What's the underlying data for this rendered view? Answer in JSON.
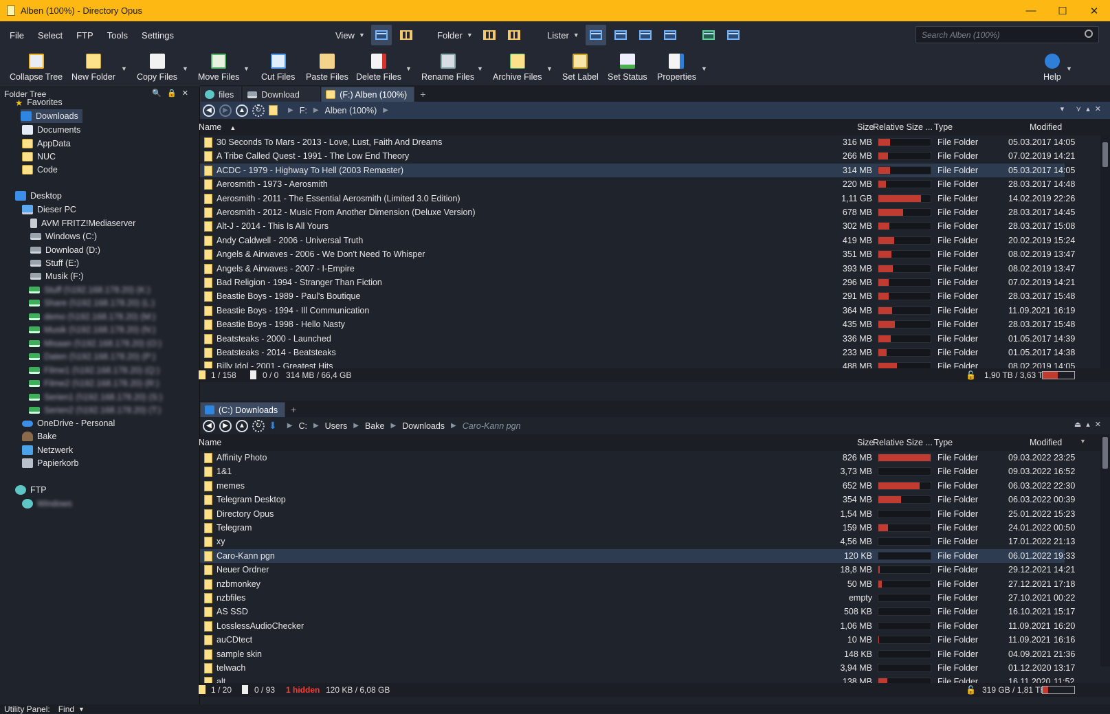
{
  "window": {
    "title": "Alben (100%) - Directory Opus",
    "min": "—",
    "max": "☐",
    "close": "✕"
  },
  "menu": {
    "file": "File",
    "select": "Select",
    "ftp": "FTP",
    "tools": "Tools",
    "settings": "Settings",
    "view": "View",
    "folder": "Folder",
    "lister": "Lister"
  },
  "search": {
    "placeholder": "Search Alben (100%)"
  },
  "toolbar": {
    "collapse_tree": "Collapse Tree",
    "new_folder": "New Folder",
    "copy_files": "Copy Files",
    "move_files": "Move Files",
    "cut_files": "Cut Files",
    "paste_files": "Paste Files",
    "delete_files": "Delete Files",
    "rename_files": "Rename Files",
    "archive_files": "Archive Files",
    "set_label": "Set Label",
    "set_status": "Set Status",
    "properties": "Properties",
    "help": "Help"
  },
  "tree": {
    "header": "Folder Tree",
    "favorites": "Favorites",
    "fav_items": [
      "Downloads",
      "Documents",
      "AppData",
      "NUC",
      "Code"
    ],
    "desktop": "Desktop",
    "this_pc": "Dieser PC",
    "pc_items": [
      "AVM FRITZ!Mediaserver",
      "Windows (C:)",
      "Download (D:)",
      "Stuff (E:)",
      "Musik (F:)"
    ],
    "net_items": [
      "Stuff (\\\\192.168.178.20) (K:)",
      "Share (\\\\192.168.178.20) (L:)",
      "demo (\\\\192.168.178.20) (M:)",
      "Musik (\\\\192.168.178.20) (N:)",
      "Misaan (\\\\192.168.178.20) (O:)",
      "Daten (\\\\192.168.178.20) (P:)",
      "Filme1 (\\\\192.168.178.20) (Q:)",
      "Filme2 (\\\\192.168.178.20) (R:)",
      "Serien1 (\\\\192.168.178.20) (S:)",
      "Serien2 (\\\\192.168.178.20) (T:)"
    ],
    "onedrive": "OneDrive - Personal",
    "bake": "Bake",
    "netzwerk": "Netzwerk",
    "papierkorb": "Papierkorb",
    "ftp": "FTP",
    "ftp_child": "Windows"
  },
  "top_lister": {
    "tabs": [
      "files",
      "Download",
      "(F:) Alben (100%)"
    ],
    "path": [
      "F:",
      "Alben (100%)"
    ],
    "columns": {
      "name": "Name",
      "size": "Size",
      "relsize": "Relative Size ...",
      "type": "Type",
      "modified": "Modified"
    },
    "rows": [
      {
        "name": "30 Seconds To Mars - 2013 - Love, Lust, Faith And Dreams",
        "size": "316 MB",
        "rel": 0.22,
        "type": "File Folder",
        "date": "05.03.2017",
        "time": "14:05"
      },
      {
        "name": "A Tribe Called Quest - 1991 - The Low End Theory",
        "size": "266 MB",
        "rel": 0.18,
        "type": "File Folder",
        "date": "07.02.2019",
        "time": "14:21"
      },
      {
        "name": "ACDC - 1979 - Highway To Hell (2003 Remaster)",
        "size": "314 MB",
        "rel": 0.22,
        "type": "File Folder",
        "date": "05.03.2017",
        "time": "14:05",
        "selected": true
      },
      {
        "name": "Aerosmith - 1973 - Aerosmith",
        "size": "220 MB",
        "rel": 0.15,
        "type": "File Folder",
        "date": "28.03.2017",
        "time": "14:48"
      },
      {
        "name": "Aerosmith - 2011 - The Essential Aerosmith (Limited 3.0 Edition)",
        "size": "1,11 GB",
        "rel": 0.82,
        "type": "File Folder",
        "date": "14.02.2019",
        "time": "22:26"
      },
      {
        "name": "Aerosmith - 2012 - Music From Another Dimension (Deluxe Version)",
        "size": "678 MB",
        "rel": 0.48,
        "type": "File Folder",
        "date": "28.03.2017",
        "time": "14:45"
      },
      {
        "name": "Alt-J - 2014 - This Is All Yours",
        "size": "302 MB",
        "rel": 0.21,
        "type": "File Folder",
        "date": "28.03.2017",
        "time": "15:08"
      },
      {
        "name": "Andy Caldwell - 2006 - Universal Truth",
        "size": "419 MB",
        "rel": 0.3,
        "type": "File Folder",
        "date": "20.02.2019",
        "time": "15:24"
      },
      {
        "name": "Angels & Airwaves - 2006 - We Don't Need To Whisper",
        "size": "351 MB",
        "rel": 0.25,
        "type": "File Folder",
        "date": "08.02.2019",
        "time": "13:47"
      },
      {
        "name": "Angels & Airwaves - 2007 - I-Empire",
        "size": "393 MB",
        "rel": 0.28,
        "type": "File Folder",
        "date": "08.02.2019",
        "time": "13:47"
      },
      {
        "name": "Bad Religion - 1994 - Stranger Than Fiction",
        "size": "296 MB",
        "rel": 0.2,
        "type": "File Folder",
        "date": "07.02.2019",
        "time": "14:21"
      },
      {
        "name": "Beastie Boys - 1989 - Paul's Boutique",
        "size": "291 MB",
        "rel": 0.2,
        "type": "File Folder",
        "date": "28.03.2017",
        "time": "15:48"
      },
      {
        "name": "Beastie Boys - 1994 - Ill Communication",
        "size": "364 MB",
        "rel": 0.26,
        "type": "File Folder",
        "date": "11.09.2021",
        "time": "16:19"
      },
      {
        "name": "Beastie Boys - 1998 - Hello Nasty",
        "size": "435 MB",
        "rel": 0.31,
        "type": "File Folder",
        "date": "28.03.2017",
        "time": "15:48"
      },
      {
        "name": "Beatsteaks - 2000 - Launched",
        "size": "336 MB",
        "rel": 0.24,
        "type": "File Folder",
        "date": "01.05.2017",
        "time": "14:39"
      },
      {
        "name": "Beatsteaks - 2014 - Beatsteaks",
        "size": "233 MB",
        "rel": 0.16,
        "type": "File Folder",
        "date": "01.05.2017",
        "time": "14:38"
      },
      {
        "name": "Billy Idol - 2001 - Greatest Hits",
        "size": "488 MB",
        "rel": 0.35,
        "type": "File Folder",
        "date": "08.02.2019",
        "time": "14:05"
      }
    ],
    "status": {
      "sel": "1 / 158",
      "files": "0 / 0",
      "size": "314 MB / 66,4 GB",
      "free": "1,90 TB / 3,63 TB",
      "free_fill": 0.48
    }
  },
  "bottom_lister": {
    "tabs": [
      "(C:) Downloads"
    ],
    "path": [
      "C:",
      "Users",
      "Bake",
      "Downloads",
      "Caro-Kann pgn"
    ],
    "columns": {
      "name": "Name",
      "size": "Size",
      "relsize": "Relative Size ...",
      "type": "Type",
      "modified": "Modified"
    },
    "rows": [
      {
        "name": "Affinity Photo",
        "size": "826 MB",
        "rel": 1.0,
        "type": "File Folder",
        "date": "09.03.2022",
        "time": "23:25"
      },
      {
        "name": "1&1",
        "size": "3,73 MB",
        "rel": 0.0,
        "type": "File Folder",
        "date": "09.03.2022",
        "time": "16:52"
      },
      {
        "name": "memes",
        "size": "652 MB",
        "rel": 0.79,
        "type": "File Folder",
        "date": "06.03.2022",
        "time": "22:30"
      },
      {
        "name": "Telegram Desktop",
        "size": "354 MB",
        "rel": 0.43,
        "type": "File Folder",
        "date": "06.03.2022",
        "time": "00:39"
      },
      {
        "name": "Directory Opus",
        "size": "1,54 MB",
        "rel": 0.0,
        "type": "File Folder",
        "date": "25.01.2022",
        "time": "15:23"
      },
      {
        "name": "Telegram",
        "size": "159 MB",
        "rel": 0.19,
        "type": "File Folder",
        "date": "24.01.2022",
        "time": "00:50"
      },
      {
        "name": "xy",
        "size": "4,56 MB",
        "rel": 0.0,
        "type": "File Folder",
        "date": "17.01.2022",
        "time": "21:13"
      },
      {
        "name": "Caro-Kann pgn",
        "size": "120 KB",
        "rel": 0.0,
        "type": "File Folder",
        "date": "06.01.2022",
        "time": "19:33",
        "selected": true
      },
      {
        "name": "Neuer Ordner",
        "size": "18,8 MB",
        "rel": 0.02,
        "type": "File Folder",
        "date": "29.12.2021",
        "time": "14:21"
      },
      {
        "name": "nzbmonkey",
        "size": "50 MB",
        "rel": 0.06,
        "type": "File Folder",
        "date": "27.12.2021",
        "time": "17:18"
      },
      {
        "name": "nzbfiles",
        "size": "empty",
        "rel": 0.0,
        "type": "File Folder",
        "date": "27.10.2021",
        "time": "00:22"
      },
      {
        "name": "AS SSD",
        "size": "508 KB",
        "rel": 0.0,
        "type": "File Folder",
        "date": "16.10.2021",
        "time": "15:17"
      },
      {
        "name": "LosslessAudioChecker",
        "size": "1,06 MB",
        "rel": 0.0,
        "type": "File Folder",
        "date": "11.09.2021",
        "time": "16:20"
      },
      {
        "name": "auCDtect",
        "size": "10 MB",
        "rel": 0.01,
        "type": "File Folder",
        "date": "11.09.2021",
        "time": "16:16"
      },
      {
        "name": "sample skin",
        "size": "148 KB",
        "rel": 0.0,
        "type": "File Folder",
        "date": "04.09.2021",
        "time": "21:36"
      },
      {
        "name": "telwach",
        "size": "3,94 MB",
        "rel": 0.0,
        "type": "File Folder",
        "date": "01.12.2020",
        "time": "13:17"
      },
      {
        "name": "alt",
        "size": "138 MB",
        "rel": 0.17,
        "type": "File Folder",
        "date": "16.11.2020",
        "time": "11:52"
      }
    ],
    "status": {
      "sel": "1 / 20",
      "files": "0 / 93",
      "hidden": "1 hidden",
      "size": "120 KB / 6,08 GB",
      "free": "319 GB / 1,81 TB",
      "free_fill": 0.17
    }
  },
  "utility": {
    "label": "Utility Panel:",
    "mode": "Find"
  },
  "colors": {
    "title_bar": "#fdb813",
    "accent_bar": "#c23b30",
    "selection": "#2e3c52",
    "hidden_text": "#ff3b30"
  }
}
